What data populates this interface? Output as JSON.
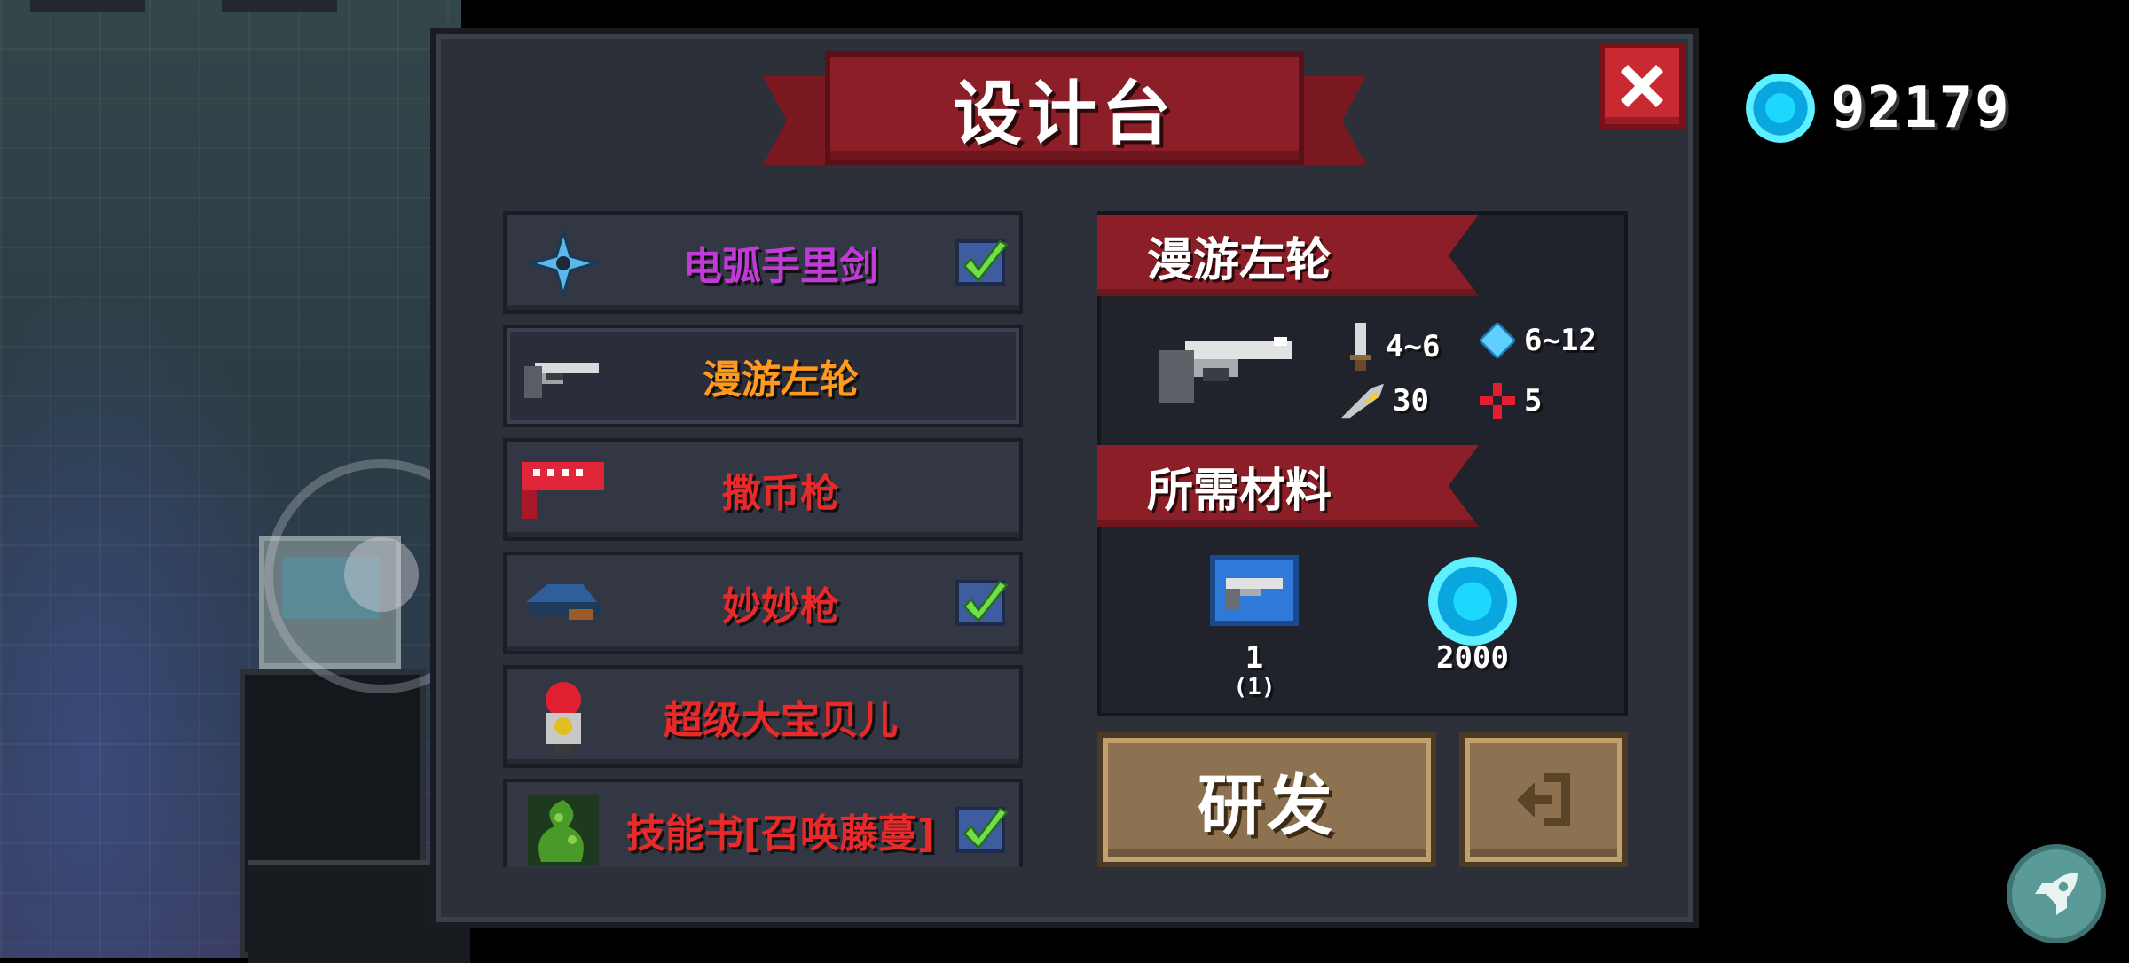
{
  "title": "设计台",
  "currency": {
    "icon": "gem-icon",
    "amount": "92179",
    "color": "#1cd8ff"
  },
  "blueprint_list": [
    {
      "name": "电弧手里剑",
      "color": "#c03ad8",
      "icon": "shuriken-icon",
      "owned": true
    },
    {
      "name": "漫游左轮",
      "color": "#ff9a1e",
      "icon": "revolver-icon",
      "owned": false,
      "selected": true
    },
    {
      "name": "撒币枪",
      "color": "#e82a2a",
      "icon": "coin-gun-icon",
      "owned": false
    },
    {
      "name": "妙妙枪",
      "color": "#e82a2a",
      "icon": "magic-gun-icon",
      "owned": true
    },
    {
      "name": "超级大宝贝儿",
      "color": "#e82a2a",
      "icon": "baby-bomb-icon",
      "owned": false
    },
    {
      "name": "技能书[召唤藤蔓]",
      "color": "#e82a2a",
      "icon": "skill-book-vine-icon",
      "owned": true
    }
  ],
  "detail": {
    "weapon_name": "漫游左轮",
    "stats": {
      "damage": "4~6",
      "energy": "6~12",
      "crit": "30",
      "accuracy": "5"
    },
    "materials_title": "所需材料",
    "materials": [
      {
        "icon": "blueprint-icon",
        "count": "1",
        "owned": "(1)"
      },
      {
        "icon": "gem-icon",
        "count": "2000"
      }
    ]
  },
  "buttons": {
    "research": "研发",
    "exit_icon": "exit-icon"
  }
}
